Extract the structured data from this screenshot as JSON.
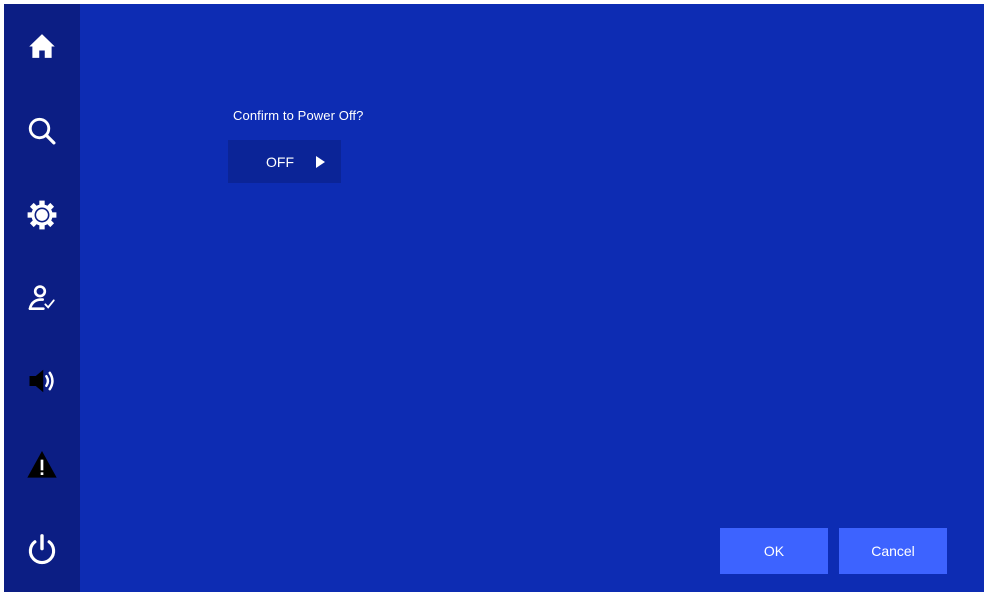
{
  "colors": {
    "sidebar": "#0c1e84",
    "main": "#0d2cb3",
    "select_bg": "#0b2497",
    "button": "#3d63ff",
    "text": "#ffffff",
    "warning_icon": "#000000"
  },
  "sidebar": {
    "items": [
      {
        "icon": "home-icon"
      },
      {
        "icon": "search-icon"
      },
      {
        "icon": "gear-icon"
      },
      {
        "icon": "user-check-icon"
      },
      {
        "icon": "speaker-icon"
      },
      {
        "icon": "warning-icon"
      },
      {
        "icon": "power-icon"
      }
    ]
  },
  "dialog": {
    "prompt": "Confirm to Power Off?",
    "selected_value": "OFF"
  },
  "buttons": {
    "ok_label": "OK",
    "cancel_label": "Cancel"
  }
}
